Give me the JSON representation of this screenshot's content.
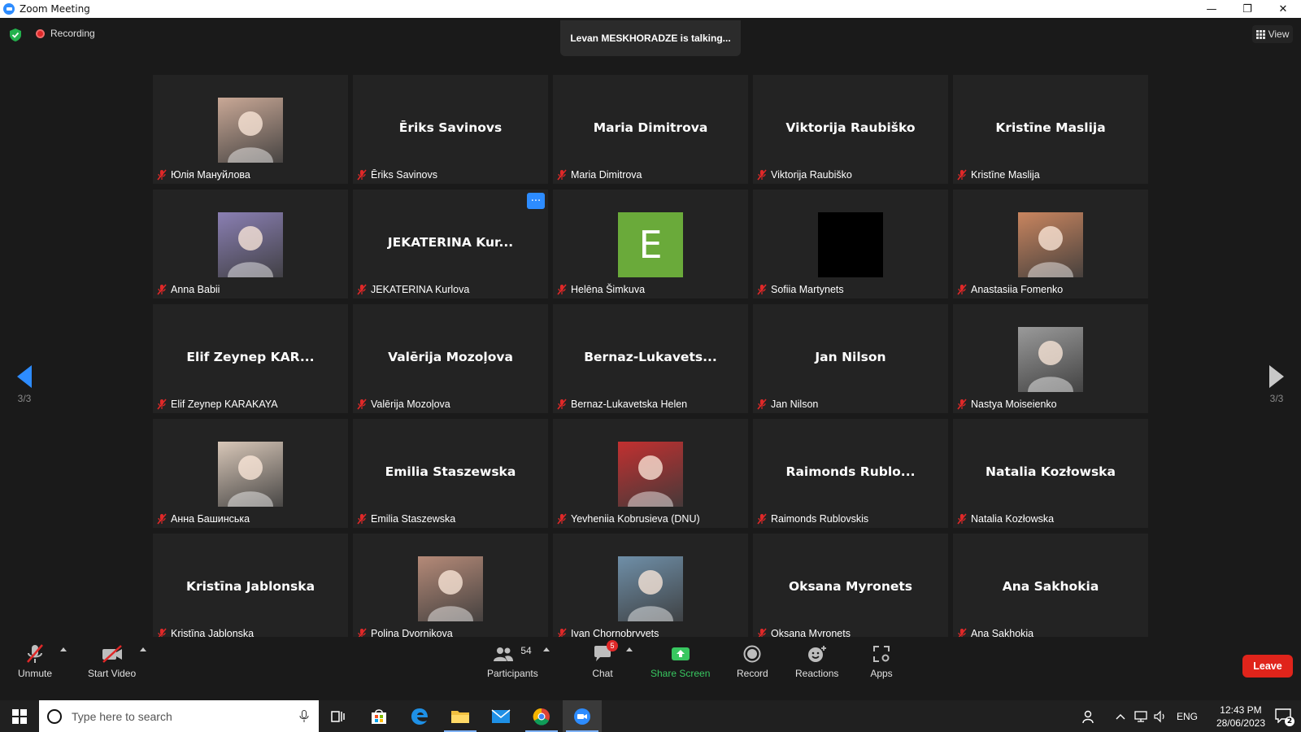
{
  "window": {
    "title": "Zoom Meeting",
    "minimize": "—",
    "restore": "❐",
    "close": "✕"
  },
  "top": {
    "recording": "Recording",
    "talking": "Levan MESKHORADZE is talking...",
    "view": "View"
  },
  "pager": {
    "left": "3/3",
    "right": "3/3"
  },
  "tiles": [
    {
      "name": "Юлія Мануйлова",
      "big": "",
      "avatar": "photo",
      "color": "#c9a896"
    },
    {
      "name": "Ēriks Savinovs",
      "big": "Ēriks Savinovs",
      "avatar": "none"
    },
    {
      "name": "Maria Dimitrova",
      "big": "Maria Dimitrova",
      "avatar": "none"
    },
    {
      "name": "Viktorija Raubiško",
      "big": "Viktorija Raubiško",
      "avatar": "none"
    },
    {
      "name": "Kristīne Maslija",
      "big": "Kristīne Maslija",
      "avatar": "none"
    },
    {
      "name": "Anna Babii",
      "big": "",
      "avatar": "photo",
      "color": "#8a7fb3"
    },
    {
      "name": "JEKATERINA Kurlova",
      "big": "JEKATERINA  Kur...",
      "avatar": "none",
      "more": "···"
    },
    {
      "name": "Helēna Šimkuva",
      "big": "",
      "avatar": "letter",
      "letter": "E",
      "color": "#6aaa3a"
    },
    {
      "name": "Sofiia Martynets",
      "big": "",
      "avatar": "black"
    },
    {
      "name": "Anastasiia Fomenko",
      "big": "",
      "avatar": "photo",
      "color": "#c9855f"
    },
    {
      "name": "Elif Zeynep KARAKAYA",
      "big": "Elif Zeynep  KAR...",
      "avatar": "none"
    },
    {
      "name": "Valērija Mozoļova",
      "big": "Valērija Mozoļova",
      "avatar": "none"
    },
    {
      "name": "Bernaz-Lukavetska Helen",
      "big": "Bernaz-Lukavets...",
      "avatar": "none"
    },
    {
      "name": "Jan Nilson",
      "big": "Jan Nilson",
      "avatar": "none"
    },
    {
      "name": "Nastya Moiseienko",
      "big": "",
      "avatar": "photo",
      "color": "#9a9a9a"
    },
    {
      "name": "Анна Башинська",
      "big": "",
      "avatar": "photo",
      "color": "#d8c7b8"
    },
    {
      "name": "Emilia Staszewska",
      "big": "Emilia Staszewska",
      "avatar": "none"
    },
    {
      "name": "Yevheniia Kobrusieva (DNU)",
      "big": "",
      "avatar": "photo",
      "color": "#c23030"
    },
    {
      "name": "Raimonds Rublovskis",
      "big": "Raimonds  Rublo...",
      "avatar": "none"
    },
    {
      "name": "Natalia Kozłowska",
      "big": "Natalia Kozłowska",
      "avatar": "none"
    },
    {
      "name": "Kristīna Jablonska",
      "big": "Kristīna Jablonska",
      "avatar": "none"
    },
    {
      "name": "Polina Dvornikova",
      "big": "",
      "avatar": "photo",
      "color": "#b58a78"
    },
    {
      "name": "Ivan Chornobryvets",
      "big": "",
      "avatar": "photo",
      "color": "#6f8fa8"
    },
    {
      "name": "Oksana Myronets",
      "big": "Oksana Myronets",
      "avatar": "none"
    },
    {
      "name": "Ana Sakhokia",
      "big": "Ana Sakhokia",
      "avatar": "none"
    }
  ],
  "toolbar": {
    "unmute": "Unmute",
    "start_video": "Start Video",
    "participants": "Participants",
    "participants_count": "54",
    "chat": "Chat",
    "chat_badge": "5",
    "share": "Share Screen",
    "record": "Record",
    "reactions": "Reactions",
    "apps": "Apps",
    "leave": "Leave"
  },
  "taskbar": {
    "search_placeholder": "Type here to search",
    "lang": "ENG",
    "time": "12:43 PM",
    "date": "28/06/2023",
    "notifications": "2"
  },
  "colors": {
    "accent": "#2d8cff",
    "leave": "#e0241b",
    "share": "#38c760",
    "muted": "#e02828"
  }
}
